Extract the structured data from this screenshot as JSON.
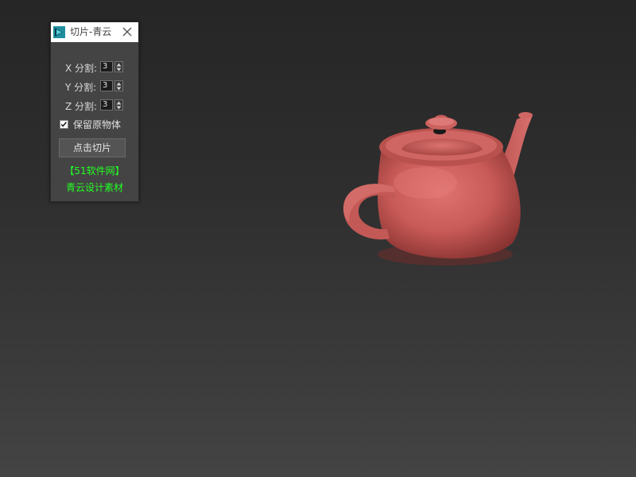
{
  "dialog": {
    "title": "切片-青云",
    "rows": [
      {
        "label": "X 分割:",
        "value": "3"
      },
      {
        "label": "Y 分割:",
        "value": "3"
      },
      {
        "label": "Z 分割:",
        "value": "3"
      }
    ],
    "keep_original_label": "保留原物体",
    "keep_original_checked": true,
    "slice_button_label": "点击切片",
    "credit_line1": "【51软件网】",
    "credit_line2": "青云设计素材"
  },
  "colors": {
    "panel_bg": "#444444",
    "credit_text": "#22ff22",
    "teapot": "#c85a57"
  },
  "icons": [
    "3dsmax-app-icon",
    "close-icon",
    "spin-up-icon",
    "spin-down-icon",
    "checkmark-icon"
  ]
}
